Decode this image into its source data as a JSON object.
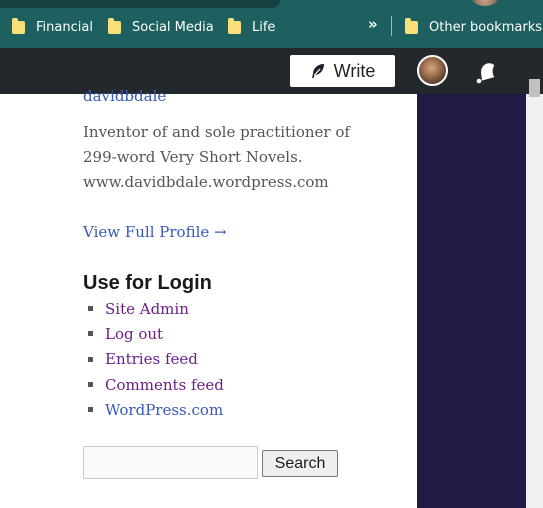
{
  "bookmarks": {
    "items": [
      {
        "label": "Financial",
        "icon": "folder-icon"
      },
      {
        "label": "Social Media",
        "icon": "folder-icon"
      },
      {
        "label": "Life",
        "icon": "folder-icon"
      }
    ],
    "overflow_label": "»",
    "other_label": "Other bookmarks",
    "bar_color": "#1e6060"
  },
  "admin_bar": {
    "write_label": "Write",
    "bar_color": "#23282d"
  },
  "author": {
    "name": "davidbdale",
    "bio_lines": [
      "Inventor of and sole practitioner of",
      "299-word Very Short Novels.",
      "www.davidbdale.wordpress.com"
    ],
    "view_profile": "View Full Profile →"
  },
  "meta_widget": {
    "title": "Use for Login",
    "links": [
      {
        "label": "Site Admin"
      },
      {
        "label": "Log out"
      },
      {
        "label": "Entries feed"
      },
      {
        "label": "Comments feed"
      },
      {
        "label": "WordPress.com"
      }
    ]
  },
  "search": {
    "value": "",
    "button_label": "Search"
  },
  "colors": {
    "link_blue": "#3759b8",
    "link_visited": "#6b1e8a",
    "sidebar_dark": "#211a45"
  }
}
